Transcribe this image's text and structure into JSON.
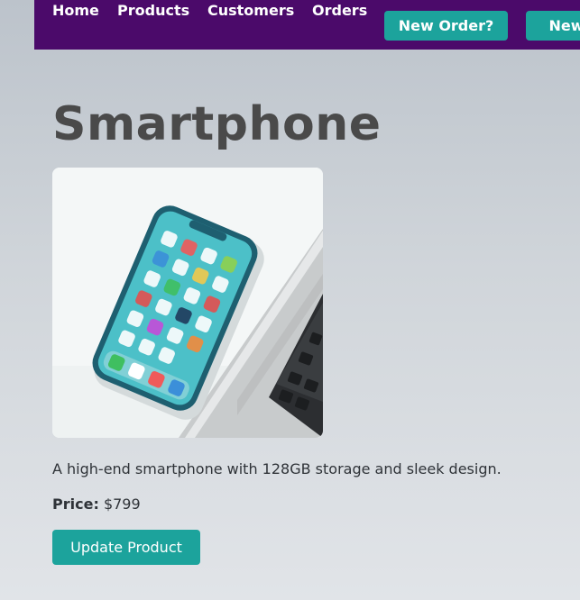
{
  "nav": {
    "links": [
      "Home",
      "Products",
      "Customers",
      "Orders"
    ],
    "buttons": [
      "New Order?",
      "New"
    ]
  },
  "product": {
    "name": "Smartphone",
    "description": "A high-end smartphone with 128GB storage and sleek design.",
    "price_label": "Price:",
    "price_value": "$799",
    "image_icon": "smartphone-photo"
  },
  "actions": {
    "update_label": "Update Product"
  },
  "colors": {
    "nav_background": "#4b0a6a",
    "accent": "#1ca39c",
    "title": "#4a4a4a",
    "body_text": "#2f3338"
  }
}
